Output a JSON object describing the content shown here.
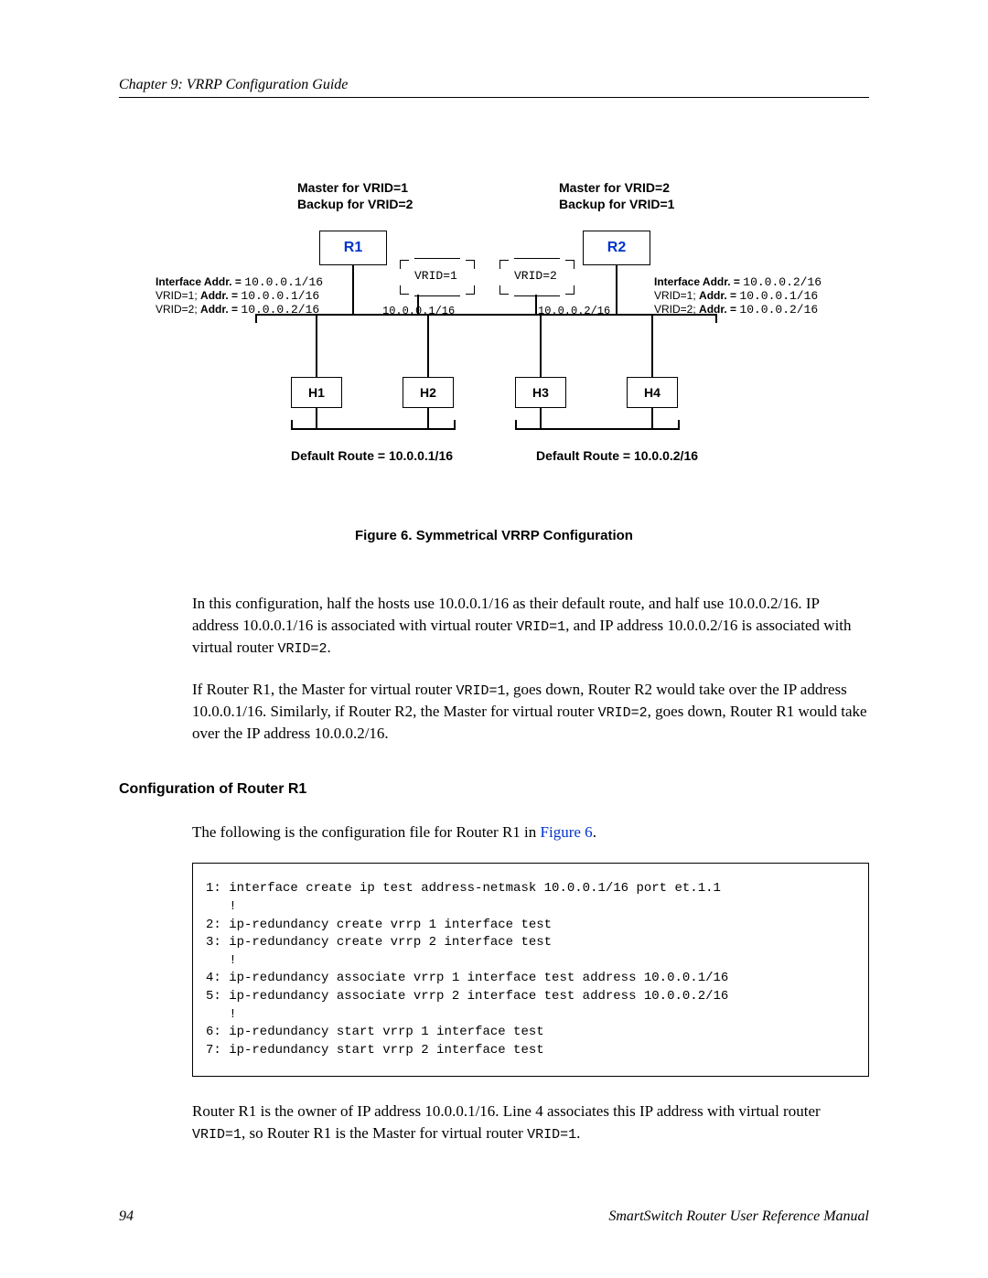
{
  "header": "Chapter 9: VRRP Configuration Guide",
  "diagram": {
    "r1_title1": "Master for VRID=1",
    "r1_title2": "Backup for VRID=2",
    "r2_title1": "Master for VRID=2",
    "r2_title2": "Backup for VRID=1",
    "r1": "R1",
    "r2": "R2",
    "vrid1": "VRID=1",
    "vrid2": "VRID=2",
    "r1_if": "Interface Addr. =",
    "r1_if_v": "10.0.0.1/16",
    "r1_v1": "VRID=1;",
    "r1_v1l": "Addr. =",
    "r1_v1v": "10.0.0.1/16",
    "r1_v2": "VRID=2;",
    "r1_v2l": "Addr. =",
    "r1_v2v": "10.0.0.2/16",
    "r2_if": "Interface Addr. =",
    "r2_if_v": "10.0.0.2/16",
    "r2_v1": "VRID=1;",
    "r2_v1l": "Addr. =",
    "r2_v1v": "10.0.0.1/16",
    "r2_v2": "VRID=2;",
    "r2_v2l": "Addr. =",
    "r2_v2v": "10.0.0.2/16",
    "ip1": "10.0.0.1/16",
    "ip2": "10.0.0.2/16",
    "h1": "H1",
    "h2": "H2",
    "h3": "H3",
    "h4": "H4",
    "dr1": "Default Route = 10.0.0.1/16",
    "dr2": "Default Route = 10.0.0.2/16"
  },
  "figure_caption": "Figure 6.  Symmetrical VRRP Configuration",
  "para1a": "In this configuration, half the hosts use 10.0.0.1/16 as their default route, and half use 10.0.0.2/16. IP address 10.0.0.1/16 is associated with virtual router ",
  "para1b": "VRID=1",
  "para1c": ", and IP address 10.0.0.2/16 is associated with virtual router ",
  "para1d": "VRID=2",
  "para1e": ".",
  "para2a": "If Router R1, the Master for virtual router ",
  "para2b": "VRID=1",
  "para2c": ", goes down, Router R2 would take over the IP address 10.0.0.1/16. Similarly, if Router R2, the Master for virtual router ",
  "para2d": "VRID=2",
  "para2e": ", goes down, Router R1 would take over the IP address 10.0.0.2/16.",
  "section_head": "Configuration of Router R1",
  "para3a": "The following is the configuration file for Router R1 in ",
  "para3b": "Figure 6",
  "para3c": ".",
  "code": "1: interface create ip test address-netmask 10.0.0.1/16 port et.1.1\n   !\n2: ip-redundancy create vrrp 1 interface test\n3: ip-redundancy create vrrp 2 interface test\n   !\n4: ip-redundancy associate vrrp 1 interface test address 10.0.0.1/16\n5: ip-redundancy associate vrrp 2 interface test address 10.0.0.2/16\n   !\n6: ip-redundancy start vrrp 1 interface test\n7: ip-redundancy start vrrp 2 interface test",
  "para4a": "Router R1 is the owner of IP address 10.0.0.1/16. Line 4 associates this IP address with virtual router ",
  "para4b": "VRID=1",
  "para4c": ", so Router R1 is the Master for virtual router ",
  "para4d": "VRID=1",
  "para4e": ".",
  "footer_page": "94",
  "footer_title": "SmartSwitch Router User Reference Manual"
}
